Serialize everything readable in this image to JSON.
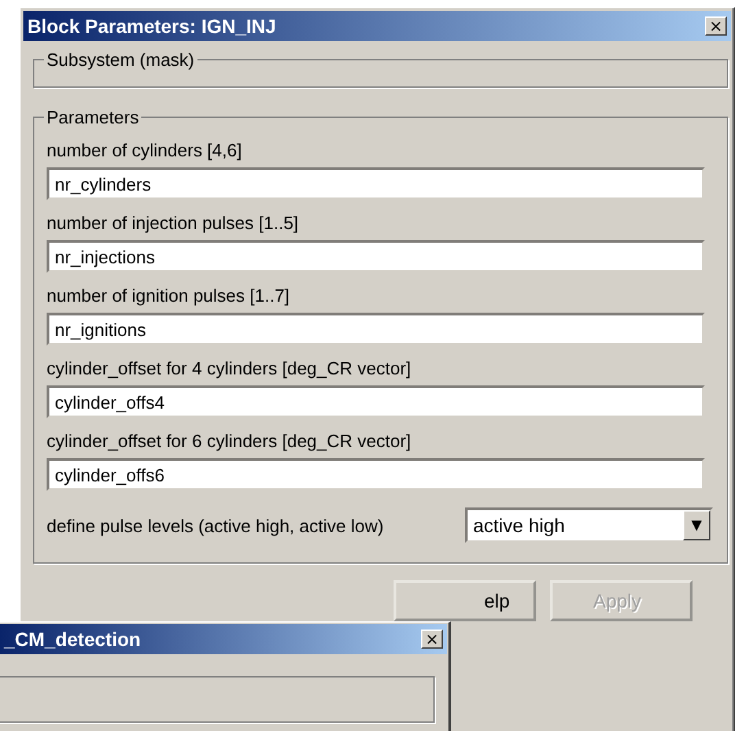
{
  "window": {
    "title": "Block Parameters: IGN_INJ",
    "close": "×"
  },
  "subsystem_group": {
    "title": "Subsystem (mask)"
  },
  "parameters_group": {
    "title": "Parameters",
    "fields": [
      {
        "label": "number of cylinders [4,6]",
        "value": "nr_cylinders"
      },
      {
        "label": "number of injection pulses [1..5]",
        "value": "nr_injections"
      },
      {
        "label": "number of ignition pulses [1..7]",
        "value": "nr_ignitions"
      },
      {
        "label": "cylinder_offset for 4 cylinders [deg_CR vector]",
        "value": "cylinder_offs4"
      },
      {
        "label": "cylinder_offset for 6 cylinders [deg_CR vector]",
        "value": "cylinder_offs6"
      }
    ],
    "dropdown": {
      "label": "define pulse levels (active high, active low)",
      "value": "active high",
      "arrow": "▼"
    }
  },
  "buttons": [
    {
      "label": "elp",
      "disabled": false
    },
    {
      "label": "Apply",
      "disabled": true
    }
  ],
  "second_window": {
    "title": "_CM_detection",
    "close": "×"
  }
}
